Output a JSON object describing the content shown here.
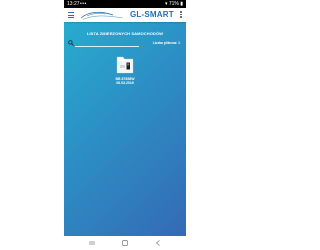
{
  "status_bar": {
    "time": "13:27",
    "notification_dots": "•••",
    "right_info": "▾ 71% ▮"
  },
  "app_bar": {
    "title": "GL-SMART"
  },
  "list": {
    "title": "LISTA ZMIERZONYCH SAMOCHODÓW",
    "count_label": "Liczba pliknow: 1",
    "search": {
      "value": "",
      "placeholder": ""
    },
    "items": [
      {
        "plate": "BB 87858W",
        "date": "08.03.2019"
      }
    ]
  },
  "colors": {
    "gradient_start": "#27b0d2",
    "gradient_end": "#3567b4",
    "title_blue": "#1f6fb8",
    "folder_white": "#ffffff"
  },
  "icons": {
    "menu": "menu-icon",
    "more": "more-vertical-icon",
    "search": "search-icon",
    "folder": "folder-car-icon",
    "nav_recent": "recent-apps-icon",
    "nav_home": "home-icon",
    "nav_back": "back-icon"
  }
}
